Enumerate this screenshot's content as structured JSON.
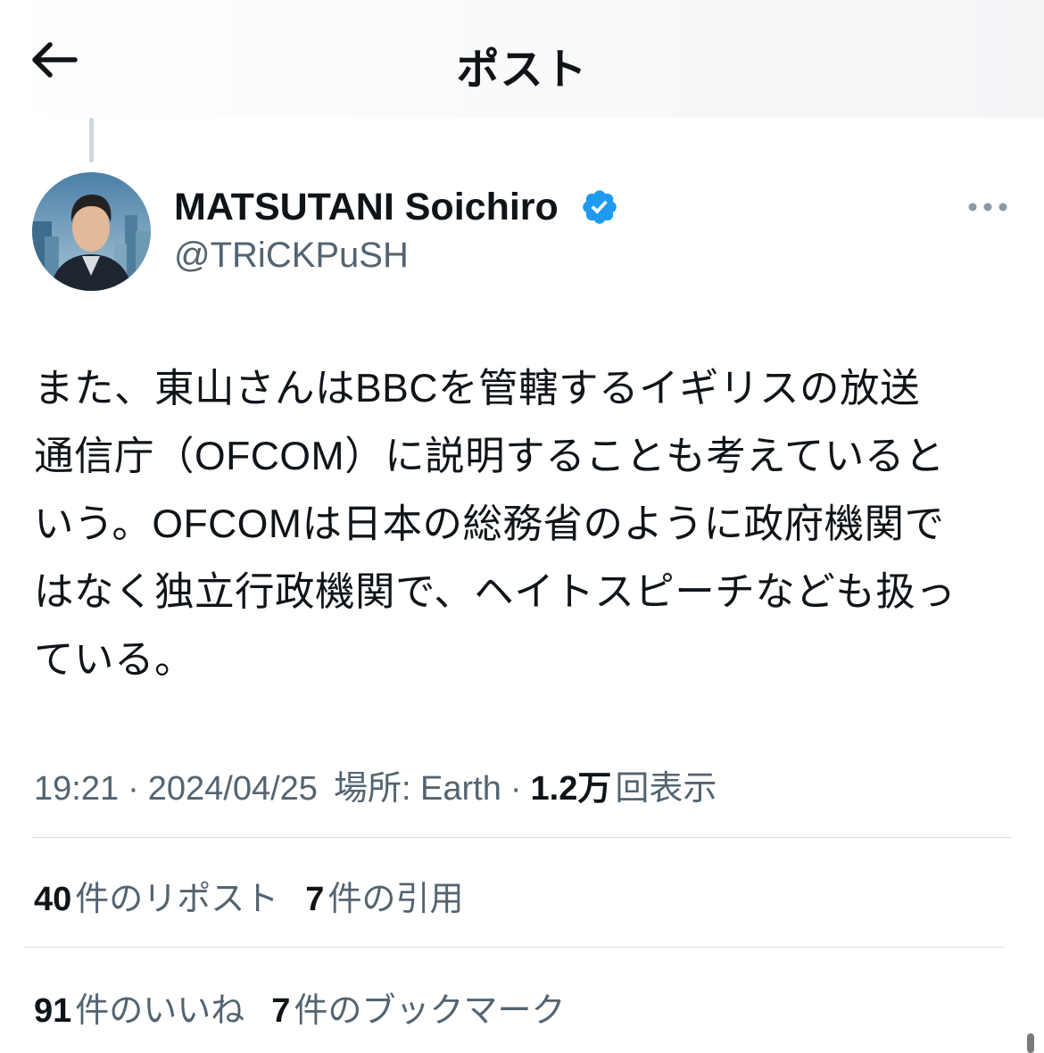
{
  "header": {
    "title": "ポスト",
    "back_icon": "arrow-left-icon"
  },
  "author": {
    "name": "MATSUTANI Soichiro",
    "handle": "@TRiCKPuSH",
    "verified": true,
    "verified_color": "#1d9bf0"
  },
  "tweet": {
    "text": "また、東山さんはBBCを管轄するイギリスの放送\n通信庁（OFCOM）に説明することも考えていると\nいう。OFCOMは日本の総務省のように政府機関で\nはなく独立行政機関で、ヘイトスピーチなども扱っ\nている。"
  },
  "meta": {
    "time": "19:21",
    "sep1": "·",
    "date": "2024/04/25",
    "location": "場所: Earth",
    "sep2": "·",
    "views_count": "1.2万",
    "views_label": "回表示"
  },
  "stats": {
    "reposts_count": "40",
    "reposts_label": "件のリポスト",
    "quotes_count": "7",
    "quotes_label": "件の引用",
    "likes_count": "91",
    "likes_label": "件のいいね",
    "bookmarks_count": "7",
    "bookmarks_label": "件のブックマーク"
  },
  "colors": {
    "text_primary": "#0f1419",
    "text_secondary": "#536471",
    "divider": "#dcdfe3"
  }
}
